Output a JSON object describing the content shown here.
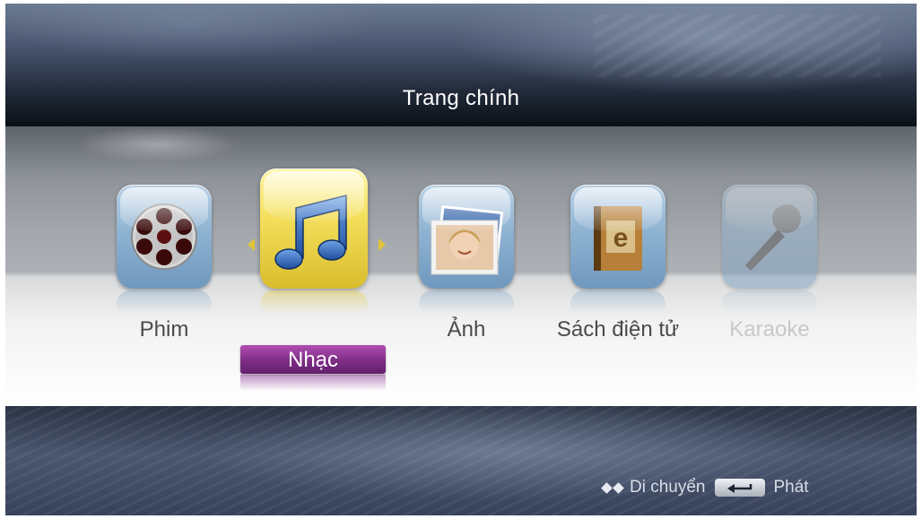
{
  "header": {
    "title": "Trang chính"
  },
  "menu": {
    "items": [
      {
        "label": "Phim",
        "icon": "film-reel-icon",
        "state": "normal"
      },
      {
        "label": "Nhạc",
        "icon": "music-note-icon",
        "state": "selected"
      },
      {
        "label": "Ảnh",
        "icon": "photo-icon",
        "state": "normal"
      },
      {
        "label": "Sách điện tử",
        "icon": "ebook-icon",
        "state": "normal"
      },
      {
        "label": "Karaoke",
        "icon": "microphone-icon",
        "state": "disabled"
      }
    ]
  },
  "hint": {
    "move_label": "Di chuyển",
    "play_label": "Phát"
  },
  "colors": {
    "selected_tile": "#f4df5c",
    "selected_label_bg": "#7d2d86"
  }
}
